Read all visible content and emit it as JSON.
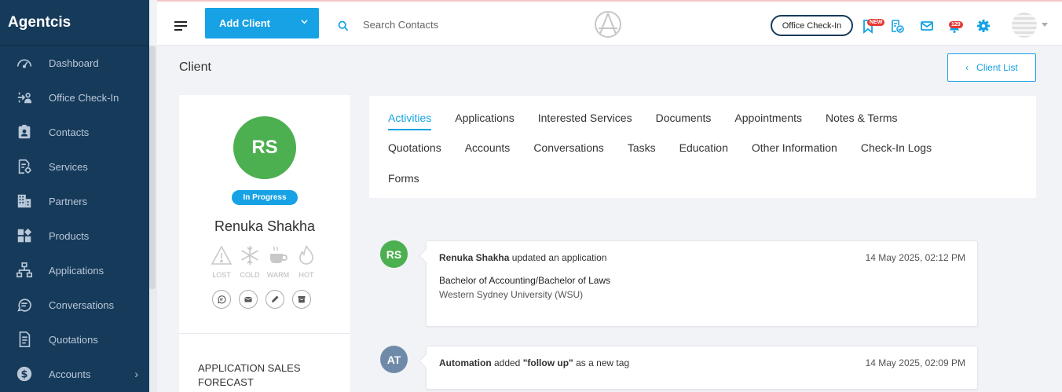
{
  "app": {
    "brand": "Agentcis"
  },
  "sidebar": {
    "items": [
      {
        "label": "Dashboard",
        "icon": "dashboard-icon"
      },
      {
        "label": "Office Check-In",
        "icon": "checkin-icon"
      },
      {
        "label": "Contacts",
        "icon": "contacts-icon"
      },
      {
        "label": "Services",
        "icon": "services-icon"
      },
      {
        "label": "Partners",
        "icon": "partners-icon"
      },
      {
        "label": "Products",
        "icon": "products-icon"
      },
      {
        "label": "Applications",
        "icon": "applications-icon"
      },
      {
        "label": "Conversations",
        "icon": "conversations-icon"
      },
      {
        "label": "Quotations",
        "icon": "quotations-icon"
      },
      {
        "label": "Accounts",
        "icon": "accounts-icon"
      }
    ]
  },
  "topbar": {
    "add_client": "Add Client",
    "search_placeholder": "Search Contacts",
    "office_checkin": "Office Check-In",
    "badge_new": "NEW",
    "badge_count": "129"
  },
  "page": {
    "title": "Client",
    "client_list": "Client List"
  },
  "profile": {
    "initials": "RS",
    "status": "In Progress",
    "name": "Renuka Shakha",
    "temperatures": [
      "LOST",
      "COLD",
      "WARM",
      "HOT"
    ],
    "forecast_title": "APPLICATION SALES FORECAST"
  },
  "tabs": {
    "row1": [
      "Activities",
      "Applications",
      "Interested Services",
      "Documents",
      "Appointments",
      "Notes & Terms"
    ],
    "row2": [
      "Quotations",
      "Accounts",
      "Conversations",
      "Tasks",
      "Education",
      "Other Information",
      "Check-In Logs"
    ],
    "row3": [
      "Forms"
    ],
    "active": "Activities"
  },
  "activities": [
    {
      "initials": "RS",
      "actor": "Renuka Shakha",
      "action": " updated an application",
      "time": "14 May 2025, 02:12 PM",
      "line1": "Bachelor of Accounting/Bachelor of Laws",
      "line2": "Western Sydney University (WSU)"
    },
    {
      "initials": "AT",
      "actor": "Automation",
      "action_pre": " added ",
      "tag": "\"follow up\"",
      "action_post": " as a new tag",
      "time": "14 May 2025, 02:09 PM"
    }
  ],
  "colors": {
    "sidebar": "#163a5a",
    "primary": "#16a2e4",
    "avatar_green": "#4caf50",
    "avatar_slate": "#6f8aa8",
    "badge_red": "#e53935"
  }
}
